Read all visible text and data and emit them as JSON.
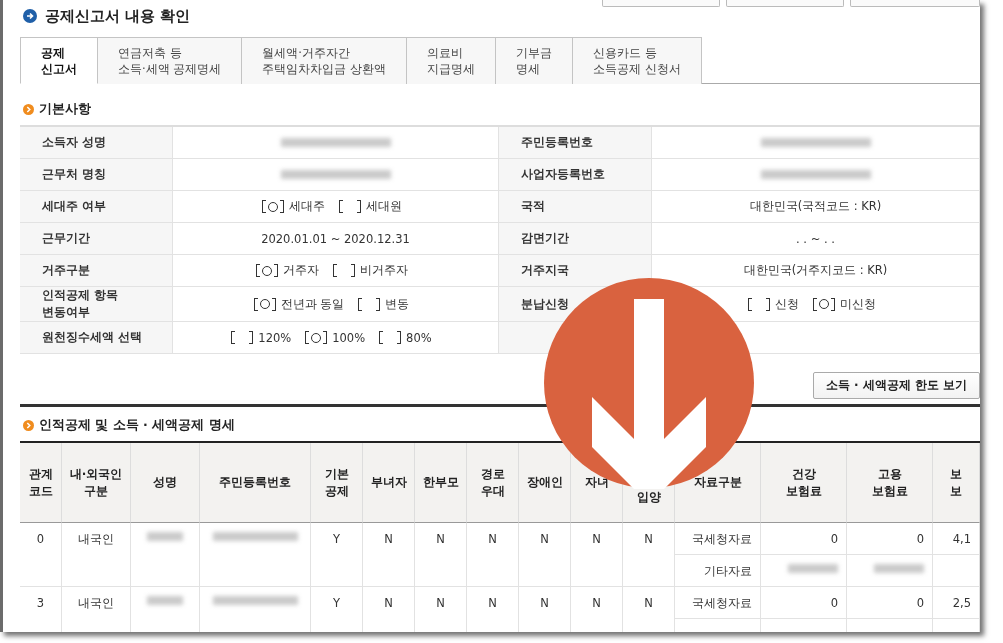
{
  "title": "공제신고서 내용 확인",
  "tabs": [
    {
      "label": "공제\n신고서",
      "selected": true
    },
    {
      "label": "연금저축 등\n소득·세액 공제명세",
      "selected": false
    },
    {
      "label": "월세액·거주자간\n주택임차차입금 상환액",
      "selected": false
    },
    {
      "label": "의료비\n지급명세",
      "selected": false
    },
    {
      "label": "기부금\n명세",
      "selected": false
    },
    {
      "label": "신용카드 등\n소득공제 신청서",
      "selected": false
    }
  ],
  "basic": {
    "heading": "기본사항",
    "rows": [
      {
        "label": "소득자 성명",
        "value": {
          "kind": "blurred"
        },
        "label2": "주민등록번호",
        "value2": {
          "kind": "blurred"
        }
      },
      {
        "label": "근무처 명칭",
        "value": {
          "kind": "blurred"
        },
        "label2": "사업자등록번호",
        "value2": {
          "kind": "blurred"
        }
      },
      {
        "label": "세대주 여부",
        "value": {
          "kind": "choice",
          "options": [
            {
              "label": "세대주",
              "selected": true
            },
            {
              "label": "세대원",
              "selected": false
            }
          ]
        },
        "label2": "국적",
        "value2": {
          "kind": "text",
          "text": "대한민국(국적코드 : KR)"
        }
      },
      {
        "label": "근무기간",
        "value": {
          "kind": "text",
          "text": "2020.01.01 ~ 2020.12.31"
        },
        "label2": "감면기간",
        "value2": {
          "kind": "text",
          "text": ". . ~ . ."
        }
      },
      {
        "label": "거주구분",
        "value": {
          "kind": "choice",
          "options": [
            {
              "label": "거주자",
              "selected": true
            },
            {
              "label": "비거주자",
              "selected": false
            }
          ]
        },
        "label2": "거주지국",
        "value2": {
          "kind": "text",
          "text": "대한민국(거주지코드 : KR)"
        }
      },
      {
        "label": "인적공제 항목\n변동여부",
        "value": {
          "kind": "choice",
          "options": [
            {
              "label": "전년과 동일",
              "selected": true
            },
            {
              "label": "변동",
              "selected": false
            }
          ]
        },
        "label2": "분납신청",
        "value2": {
          "kind": "choice",
          "options": [
            {
              "label": "신청",
              "selected": false
            },
            {
              "label": "미신청",
              "selected": true
            }
          ]
        }
      },
      {
        "label": "원천징수세액 선택",
        "value": {
          "kind": "choice",
          "options": [
            {
              "label": "120%",
              "selected": false
            },
            {
              "label": "100%",
              "selected": true
            },
            {
              "label": "80%",
              "selected": false
            }
          ]
        }
      }
    ]
  },
  "limit_button": "소득 · 세액공제 한도 보기",
  "detail": {
    "heading": "인적공제 및 소득 · 세액공제 명세",
    "columns": [
      {
        "label": "관계\n코드",
        "kind": "plain"
      },
      {
        "label": "내·외국인\n구분",
        "kind": "plain"
      },
      {
        "label": "성명",
        "kind": "plain"
      },
      {
        "label": "주민등록번호",
        "kind": "plain"
      },
      {
        "label": "기본\n공제",
        "kind": "plain"
      },
      {
        "label": "부녀자",
        "kind": "plain"
      },
      {
        "label": "한부모",
        "kind": "plain"
      },
      {
        "label": "경로\n우대",
        "kind": "plain"
      },
      {
        "label": "장애인",
        "kind": "plain"
      },
      {
        "label": "자녀",
        "kind": "plain"
      },
      {
        "label": "입양",
        "kind": "lower"
      },
      {
        "label": "자료구분",
        "kind": "plain"
      },
      {
        "label": "건강\n보험료",
        "kind": "plain"
      },
      {
        "label": "고용\n보험료",
        "kind": "plain"
      },
      {
        "label": "보\n보",
        "kind": "plain"
      }
    ],
    "rows": [
      {
        "cells": [
          {
            "kind": "text",
            "text": "0"
          },
          {
            "kind": "text",
            "text": "내국인"
          },
          {
            "kind": "blurred"
          },
          {
            "kind": "blurred"
          },
          {
            "kind": "text",
            "text": "Y"
          },
          {
            "kind": "text",
            "text": "N"
          },
          {
            "kind": "text",
            "text": "N"
          },
          {
            "kind": "text",
            "text": "N"
          },
          {
            "kind": "text",
            "text": "N"
          },
          {
            "kind": "text",
            "text": "N"
          },
          {
            "kind": "text",
            "text": "N"
          }
        ],
        "sources": [
          {
            "label": "국세청자료",
            "cells": [
              {
                "kind": "text",
                "text": "0"
              },
              {
                "kind": "text",
                "text": "0"
              },
              {
                "kind": "text",
                "text": "4,1"
              }
            ]
          },
          {
            "label": "기타자료",
            "cells": [
              {
                "kind": "blurred"
              },
              {
                "kind": "blurred"
              },
              {
                "kind": "empty"
              }
            ]
          }
        ]
      },
      {
        "cells": [
          {
            "kind": "text",
            "text": "3"
          },
          {
            "kind": "text",
            "text": "내국인"
          },
          {
            "kind": "blurred"
          },
          {
            "kind": "blurred"
          },
          {
            "kind": "text",
            "text": "Y"
          },
          {
            "kind": "text",
            "text": "N"
          },
          {
            "kind": "text",
            "text": "N"
          },
          {
            "kind": "text",
            "text": "N"
          },
          {
            "kind": "text",
            "text": "N"
          },
          {
            "kind": "text",
            "text": "N"
          },
          {
            "kind": "text",
            "text": "N"
          }
        ],
        "sources": [
          {
            "label": "국세청자료",
            "cells": [
              {
                "kind": "text",
                "text": "0"
              },
              {
                "kind": "text",
                "text": "0"
              },
              {
                "kind": "text",
                "text": "2,5"
              }
            ]
          },
          {
            "cells": [
              {
                "kind": "empty"
              },
              {
                "kind": "empty"
              },
              {
                "kind": "empty"
              }
            ]
          }
        ]
      }
    ]
  }
}
